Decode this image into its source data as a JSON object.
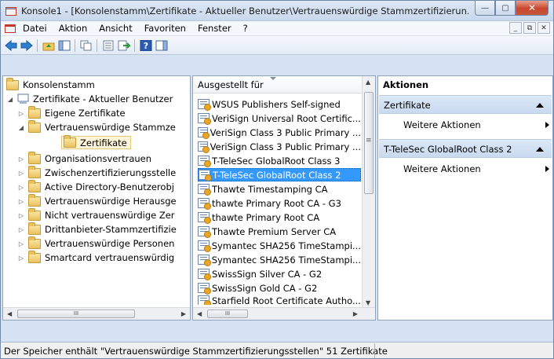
{
  "window": {
    "title": "Konsole1 - [Konsolenstamm\\Zertifikate - Aktueller Benutzer\\Vertrauenswürdige Stammzertifizierun...",
    "minimize_glyph": "—",
    "maximize_glyph": "▢",
    "close_glyph": "✕"
  },
  "menubar": {
    "items": [
      "Datei",
      "Aktion",
      "Ansicht",
      "Favoriten",
      "Fenster",
      "?"
    ],
    "mdi_minimize": "_",
    "mdi_restore": "⧉",
    "mdi_close": "✕"
  },
  "toolbar": {
    "icons": [
      "back-icon",
      "forward-icon",
      "up-folder-icon",
      "show-hide-tree-icon",
      "copy-icon",
      "properties-icon",
      "export-icon",
      "help-icon",
      "show-hide-action-pane-icon"
    ]
  },
  "tree": {
    "items": [
      {
        "label": "Konsolenstamm"
      },
      {
        "label": "Zertifikate - Aktueller Benutzer"
      },
      {
        "label": "Eigene Zertifikate"
      },
      {
        "label": "Vertrauenswürdige Stammze"
      },
      {
        "label": "Zertifikate"
      },
      {
        "label": "Organisationsvertrauen"
      },
      {
        "label": "Zwischenzertifizierungsstelle"
      },
      {
        "label": "Active Directory-Benutzerobj"
      },
      {
        "label": "Vertrauenswürdige Herausge"
      },
      {
        "label": "Nicht vertrauenswürdige Zer"
      },
      {
        "label": "Drittanbieter-Stammzertifizie"
      },
      {
        "label": "Vertrauenswürdige Personen"
      },
      {
        "label": "Smartcard vertrauenswürdig"
      }
    ],
    "hscroll_left": "◀",
    "hscroll_right": "▶",
    "hscroll_grip": "III"
  },
  "list": {
    "column_header": "Ausgestellt für",
    "rows": [
      "WSUS Publishers Self-signed",
      "VeriSign Universal Root Certific...",
      "VeriSign Class 3 Public Primary ...",
      "VeriSign Class 3 Public Primary ...",
      "T-TeleSec GlobalRoot Class 3",
      "T-TeleSec GlobalRoot Class 2",
      "Thawte Timestamping CA",
      "thawte Primary Root CA - G3",
      "thawte Primary Root CA",
      "Thawte Premium Server CA",
      "Symantec SHA256 TimeStampi...",
      "Symantec SHA256 TimeStampi...",
      "SwissSign Silver CA - G2",
      "SwissSign Gold CA - G2",
      "Starfield Root Certificate Autho..."
    ],
    "selected_index": 5,
    "vscroll_up": "▲",
    "vscroll_down": "▼",
    "vscroll_grip": "≡",
    "hscroll_left": "◀",
    "hscroll_right": "▶",
    "hscroll_grip": "III"
  },
  "actions": {
    "title": "Aktionen",
    "groups": [
      {
        "label": "Zertifikate",
        "item": "Weitere Aktionen"
      },
      {
        "label": "T-TeleSec GlobalRoot Class 2",
        "item": "Weitere Aktionen"
      }
    ]
  },
  "statusbar": {
    "text": "Der Speicher enthält \"Vertrauenswürdige Stammzertifizierungsstellen\" 51 Zertifikate"
  },
  "colors": {
    "selection": "#3399ff",
    "action_group": "#c8daf0"
  }
}
